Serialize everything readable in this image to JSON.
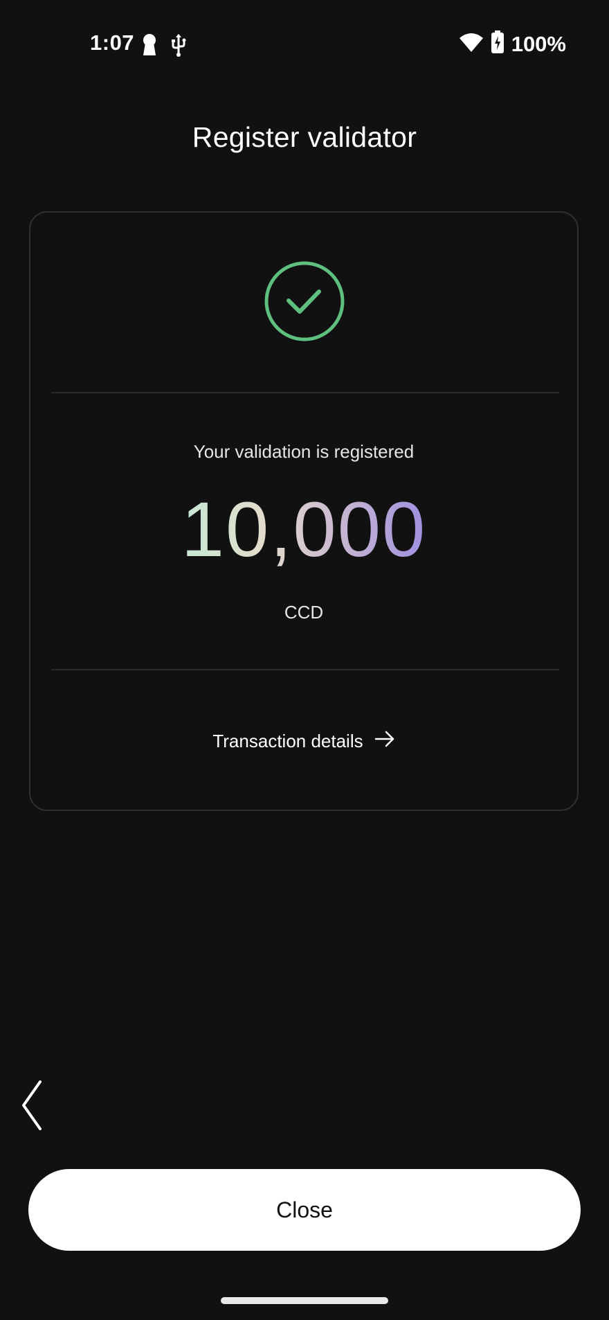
{
  "status_bar": {
    "time": "1:07",
    "battery": "100%",
    "icons": [
      "keyhole-icon",
      "usb-icon",
      "wifi-icon",
      "battery-charging-icon"
    ]
  },
  "header": {
    "title": "Register validator"
  },
  "card": {
    "success_icon": "check-circle-icon",
    "success_color": "#5fbf7f",
    "message": "Your validation is registered",
    "amount": "10,000",
    "currency": "CCD",
    "transaction_link": "Transaction details",
    "transaction_link_icon": "arrow-right-icon"
  },
  "navigation": {
    "back_icon": "chevron-left-icon"
  },
  "footer": {
    "close_label": "Close"
  }
}
